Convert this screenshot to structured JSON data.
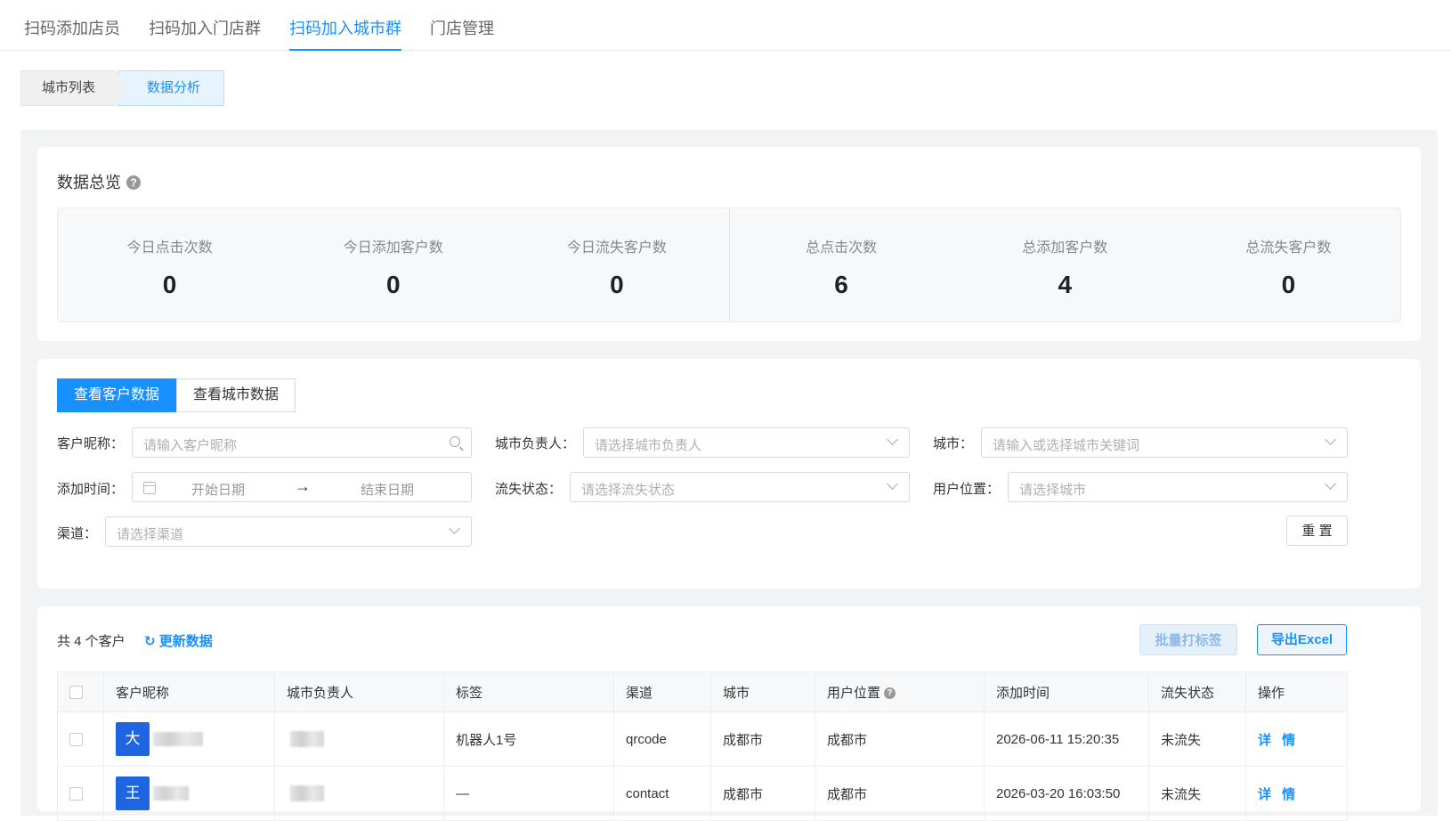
{
  "top_tabs": [
    "扫码添加店员",
    "扫码加入门店群",
    "扫码加入城市群",
    "门店管理"
  ],
  "active_tab_index": 2,
  "steps": {
    "step1": "城市列表",
    "step2": "数据分析"
  },
  "overview": {
    "title": "数据总览",
    "help_icon": "?",
    "today": [
      {
        "label": "今日点击次数",
        "value": "0"
      },
      {
        "label": "今日添加客户数",
        "value": "0"
      },
      {
        "label": "今日流失客户数",
        "value": "0"
      }
    ],
    "total": [
      {
        "label": "总点击次数",
        "value": "6"
      },
      {
        "label": "总添加客户数",
        "value": "4"
      },
      {
        "label": "总流失客户数",
        "value": "0"
      }
    ]
  },
  "segment": {
    "customer": "查看客户数据",
    "city": "查看城市数据"
  },
  "filters": {
    "nickname": {
      "label": "客户昵称：",
      "placeholder": "请输入客户昵称"
    },
    "city_owner": {
      "label": "城市负责人：",
      "placeholder": "请选择城市负责人"
    },
    "city": {
      "label": "城市：",
      "placeholder": "请输入或选择城市关键词"
    },
    "add_time": {
      "label": "添加时间：",
      "start": "开始日期",
      "end": "结束日期",
      "arrow": "→"
    },
    "lost_status": {
      "label": "流失状态：",
      "placeholder": "请选择流失状态"
    },
    "user_location": {
      "label": "用户位置：",
      "placeholder": "请选择城市"
    },
    "channel": {
      "label": "渠道：",
      "placeholder": "请选择渠道"
    },
    "reset": "重 置"
  },
  "table_header": {
    "count": "共 4 个客户",
    "refresh_icon": "↻",
    "refresh": "更新数据",
    "batch_tag": "批量打标签",
    "export": "导出Excel"
  },
  "columns": [
    "客户昵称",
    "城市负责人",
    "标签",
    "渠道",
    "城市",
    "用户位置",
    "添加时间",
    "流失状态",
    "操作"
  ],
  "rows": [
    {
      "avatar": "大",
      "tag": "机器人1号",
      "channel": "qrcode",
      "city": "成都市",
      "location": "成都市",
      "time": "2026-06-11 15:20:35",
      "status": "未流失",
      "action": "详 情"
    },
    {
      "avatar": "王",
      "tag": "—",
      "channel": "contact",
      "city": "成都市",
      "location": "成都市",
      "time": "2026-03-20 16:03:50",
      "status": "未流失",
      "action": "详 情"
    }
  ]
}
